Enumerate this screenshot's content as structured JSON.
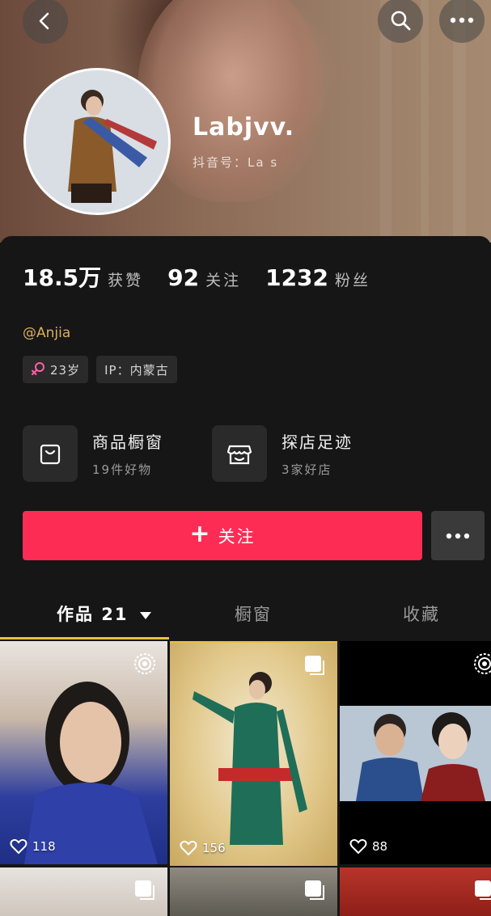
{
  "header": {
    "back_icon": "back-arrow-icon",
    "search_icon": "search-icon",
    "more_icon": "more-dots-icon"
  },
  "profile": {
    "nickname": "Labjvv.",
    "douyin_id": "抖音号：La s",
    "mention": "@Anjia",
    "tags": [
      {
        "icon": "female-icon",
        "label": "23岁"
      },
      {
        "label": "IP：内蒙古"
      }
    ]
  },
  "stats": [
    {
      "value": "18.5万",
      "label": "获赞"
    },
    {
      "value": "92",
      "label": "关注"
    },
    {
      "value": "1232",
      "label": "粉丝"
    }
  ],
  "features": [
    {
      "icon": "shopping-bag-icon",
      "title": "商品橱窗",
      "subtitle": "19件好物"
    },
    {
      "icon": "storefront-icon",
      "title": "探店足迹",
      "subtitle": "3家好店"
    }
  ],
  "actions": {
    "follow_label": "关注",
    "more_icon": "more-dots-icon"
  },
  "tabs": [
    {
      "label": "作品 21",
      "active": true
    },
    {
      "label": "橱窗",
      "active": false
    },
    {
      "label": "收藏",
      "active": false
    }
  ],
  "videos": [
    {
      "likes": "118",
      "badge": "live-photo-icon"
    },
    {
      "likes": "156",
      "badge": "multi-image-icon"
    },
    {
      "likes": "88",
      "badge": "live-photo-icon"
    }
  ],
  "colors": {
    "accent": "#fd2c55",
    "mention": "#d9b15c",
    "tab_underline": "#e8c13a",
    "background": "#161616"
  }
}
